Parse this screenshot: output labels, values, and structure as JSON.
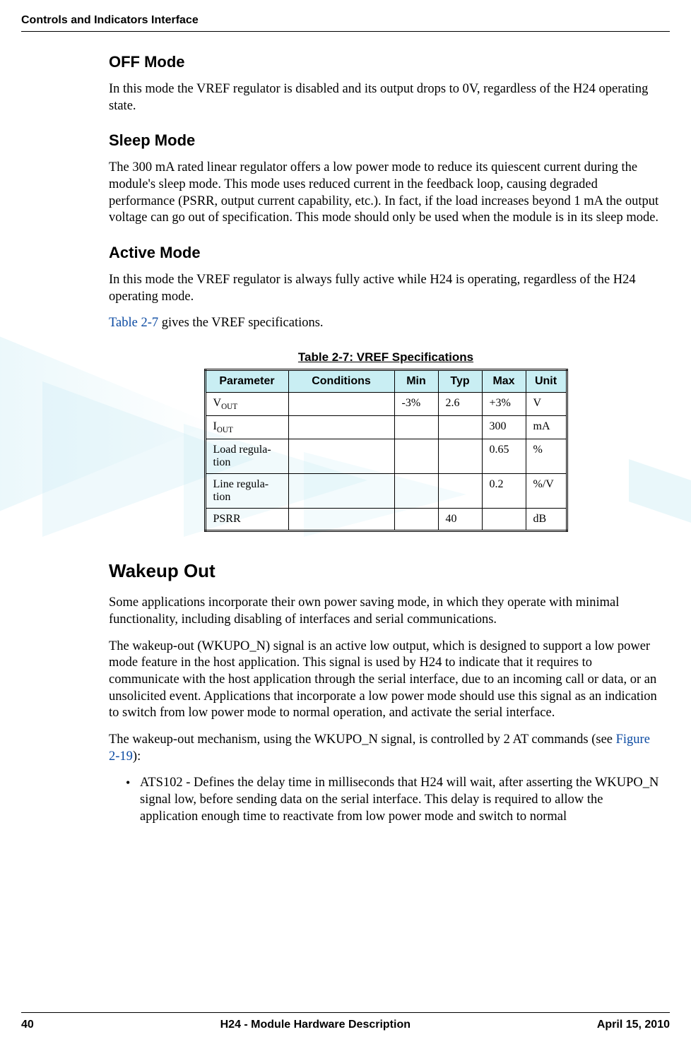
{
  "running_head": "Controls and Indicators Interface",
  "sections": {
    "off_mode": {
      "title": "OFF Mode",
      "p1": "In this mode the VREF regulator is disabled and its output drops to 0V, regardless of the H24 operating state."
    },
    "sleep_mode": {
      "title": "Sleep Mode",
      "p1": "The 300 mA rated linear regulator offers a low power mode to reduce its quiescent current during the module's sleep mode. This mode uses reduced current in the feedback loop, causing degraded performance (PSRR, output current capability, etc.). In fact, if the load increases beyond 1 mA the output voltage can go out of specification. This mode should only be used when the module is in its sleep mode."
    },
    "active_mode": {
      "title": "Active Mode",
      "p1": "In this mode the VREF regulator is always fully active while H24 is operating, regardless of the H24 operating mode.",
      "p2_pre": "",
      "p2_link": "Table 2-7",
      "p2_post": " gives the VREF specifications."
    },
    "wakeup_out": {
      "title": "Wakeup Out",
      "p1": "Some applications incorporate their own power saving mode, in which they operate with minimal functionality, including disabling of interfaces and serial communications.",
      "p2": "The wakeup-out (WKUPO_N) signal is an active low output, which is designed to support a low power mode feature in the host application. This signal is used by H24 to indicate that it requires to communicate with the host application through the serial interface, due to an incoming call or data, or an unsolicited event. Applications that incorporate a low power mode should use this signal as an indication to switch from low power mode to normal operation, and activate the serial interface.",
      "p3_pre": "The wakeup-out mechanism, using the WKUPO_N signal, is controlled by 2 AT commands (see ",
      "p3_link": "Figure 2-19",
      "p3_post": "):",
      "bullet1": "ATS102 - Defines the delay time in milliseconds that H24 will wait, after asserting the WKUPO_N signal low, before sending data on the serial interface. This delay is required to allow the application enough time to reactivate from low power mode and switch to normal"
    }
  },
  "table": {
    "caption": "Table 2-7: VREF Specifications",
    "headers": [
      "Parameter",
      "Conditions",
      "Min",
      "Typ",
      "Max",
      "Unit"
    ],
    "rows": [
      {
        "param_html": "V<sub>OUT</sub>",
        "cond": "",
        "min": "-3%",
        "typ": "2.6",
        "max": "+3%",
        "unit": "V"
      },
      {
        "param_html": "I<sub>OUT</sub>",
        "cond": "",
        "min": "",
        "typ": "",
        "max": "300",
        "unit": "mA"
      },
      {
        "param_html": "Load regula-<br>tion",
        "cond": "",
        "min": "",
        "typ": "",
        "max": "0.65",
        "unit": "%"
      },
      {
        "param_html": "Line regula-<br>tion",
        "cond": "",
        "min": "",
        "typ": "",
        "max": "0.2",
        "unit": "%/V"
      },
      {
        "param_html": "PSRR",
        "cond": "",
        "min": "",
        "typ": "40",
        "max": "",
        "unit": "dB"
      }
    ]
  },
  "footer": {
    "page": "40",
    "center": "H24 - Module Hardware Description",
    "date": "April 15, 2010"
  },
  "chart_data": {
    "type": "table",
    "title": "Table 2-7: VREF Specifications",
    "columns": [
      "Parameter",
      "Conditions",
      "Min",
      "Typ",
      "Max",
      "Unit"
    ],
    "rows": [
      [
        "VOUT",
        "",
        "-3%",
        "2.6",
        "+3%",
        "V"
      ],
      [
        "IOUT",
        "",
        "",
        "",
        "300",
        "mA"
      ],
      [
        "Load regulation",
        "",
        "",
        "",
        "0.65",
        "%"
      ],
      [
        "Line regulation",
        "",
        "",
        "",
        "0.2",
        "%/V"
      ],
      [
        "PSRR",
        "",
        "",
        "40",
        "",
        "dB"
      ]
    ]
  }
}
